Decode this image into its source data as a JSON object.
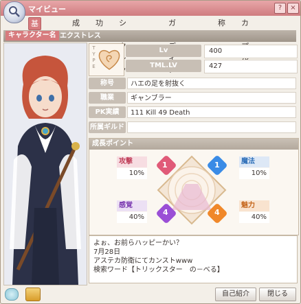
{
  "window": {
    "title": "マイビュー",
    "help_label": "?",
    "close_label": "×"
  },
  "tabs": [
    {
      "label": "基本情報",
      "active": true
    },
    {
      "label": "成長"
    },
    {
      "label": "功績"
    },
    {
      "label": "シークレット"
    },
    {
      "label": "ガーディアン"
    },
    {
      "label": "称号"
    },
    {
      "label": "カップル"
    }
  ],
  "character": {
    "name_label": "キャラクター名",
    "name_value": "エクストレス"
  },
  "type_box": {
    "letters": "T Y P E",
    "icon": "heart-spiral-icon"
  },
  "level": {
    "label": "Lv",
    "value": "400"
  },
  "tml": {
    "label": "TML.LV",
    "value": "427"
  },
  "title_field": {
    "label": "称号",
    "value": "ハエの足を射抜く"
  },
  "job_field": {
    "label": "職業",
    "value": "ギャンブラー"
  },
  "pk_field": {
    "label": "PK実績",
    "value": "111 Kill  49 Death"
  },
  "guild_field": {
    "label": "所属ギルド",
    "value": ""
  },
  "growth": {
    "title": "成長ポイント",
    "stats": [
      {
        "label": "攻撃",
        "percent": "10%",
        "gem_value": "1",
        "color": "#e05a78"
      },
      {
        "label": "魔法",
        "percent": "10%",
        "gem_value": "1",
        "color": "#3a8be6"
      },
      {
        "label": "感覚",
        "percent": "40%",
        "gem_value": "4",
        "color": "#9a4fd6"
      },
      {
        "label": "魅力",
        "percent": "40%",
        "gem_value": "4",
        "color": "#f0882a"
      }
    ]
  },
  "message": {
    "lines": [
      "よぉ、お前らハッピーかい？",
      "7月28日",
      "アステカ防衛にてカンストwww",
      "検索ワード【トリックスター　の－べる】"
    ]
  },
  "footer": {
    "intro_button": "自己紹介",
    "close_button": "閉じる"
  },
  "colors": {
    "accent": "#d77b7e",
    "title_bar": "#cf7c80"
  }
}
